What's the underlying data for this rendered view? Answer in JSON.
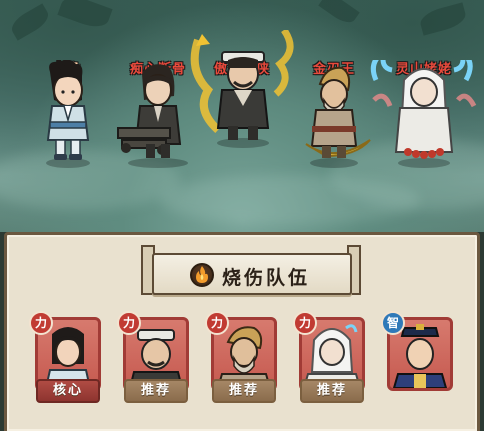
{
  "scene": {
    "heroes": [
      {
        "name": "主角",
        "color": "#f7c9a3"
      },
      {
        "name": "痴心断骨",
        "color": "#e94a3c"
      },
      {
        "name": "傲气北侠",
        "color": "#e94a3c"
      },
      {
        "name": "金刃王",
        "color": "#e94a3c"
      },
      {
        "name": "灵山姥姥",
        "color": "#e94a3c"
      }
    ]
  },
  "panel": {
    "title": "烧伤队伍",
    "title_icon": "flame-icon",
    "cards": [
      {
        "badge": "力",
        "badge_type": "red",
        "tag": "核心",
        "tag_type": "core"
      },
      {
        "badge": "力",
        "badge_type": "red",
        "tag": "推荐",
        "tag_type": "recommend"
      },
      {
        "badge": "力",
        "badge_type": "red",
        "tag": "推荐",
        "tag_type": "recommend"
      },
      {
        "badge": "力",
        "badge_type": "red",
        "tag": "推荐",
        "tag_type": "recommend"
      },
      {
        "badge": "智",
        "badge_type": "blue",
        "tag": "",
        "tag_type": "none"
      }
    ]
  }
}
